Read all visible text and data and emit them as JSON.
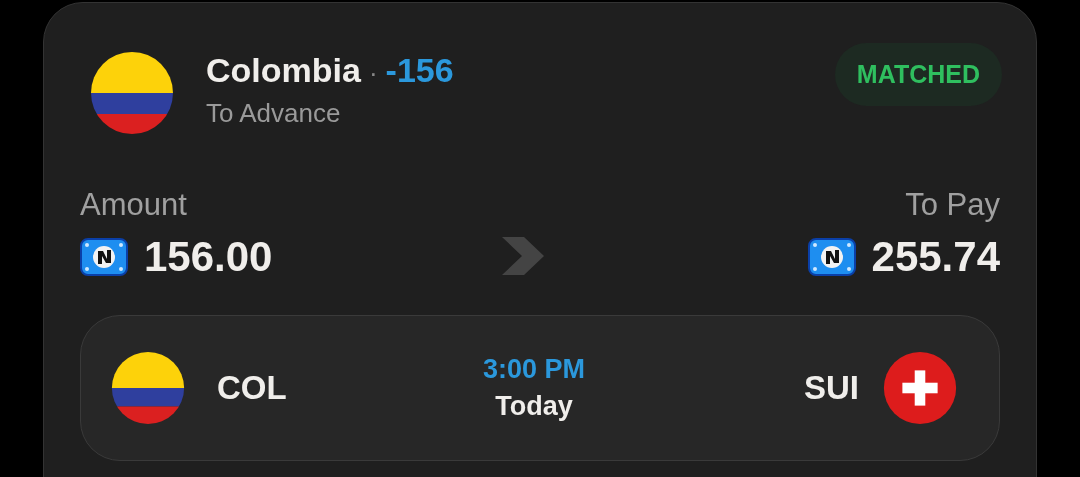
{
  "bet": {
    "flag": {
      "kind": "colombia"
    },
    "country": "Colombia",
    "separator": "·",
    "line": "-156",
    "subtitle": "To Advance",
    "status": "MATCHED",
    "amount_label": "Amount",
    "amount": "156.00",
    "to_pay_label": "To Pay",
    "to_pay": "255.74",
    "match": {
      "home": {
        "code": "COL",
        "flag": {
          "kind": "colombia"
        }
      },
      "time": "3:00 PM",
      "day": "Today",
      "away": {
        "code": "SUI",
        "flag": {
          "kind": "switzerland"
        }
      }
    }
  }
}
